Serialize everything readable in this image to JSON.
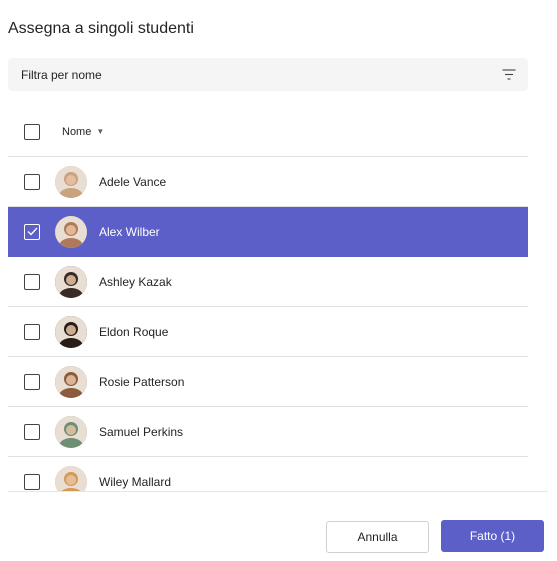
{
  "dialog": {
    "title": "Assegna a singoli studenti"
  },
  "filter": {
    "placeholder": "Filtra per nome",
    "icon": "filter-icon"
  },
  "table": {
    "header_label": "Nome",
    "sort_icon": "caret-down-icon"
  },
  "students": [
    {
      "name": "Adele Vance",
      "selected": false,
      "avatar_color": "#c9a27e"
    },
    {
      "name": "Alex Wilber",
      "selected": true,
      "avatar_color": "#b07a5a"
    },
    {
      "name": "Ashley Kazak",
      "selected": false,
      "avatar_color": "#3a2a26"
    },
    {
      "name": "Eldon Roque",
      "selected": false,
      "avatar_color": "#2a1d18"
    },
    {
      "name": "Rosie Patterson",
      "selected": false,
      "avatar_color": "#8a5b3c"
    },
    {
      "name": "Samuel Perkins",
      "selected": false,
      "avatar_color": "#6f8f74"
    },
    {
      "name": "Wiley Mallard",
      "selected": false,
      "avatar_color": "#d29a54"
    }
  ],
  "buttons": {
    "cancel_label": "Annulla",
    "done_label": "Fatto (1)"
  },
  "colors": {
    "accent": "#5b5fc7",
    "filter_bg": "#f5f5f5",
    "divider": "#e0e0e0"
  }
}
